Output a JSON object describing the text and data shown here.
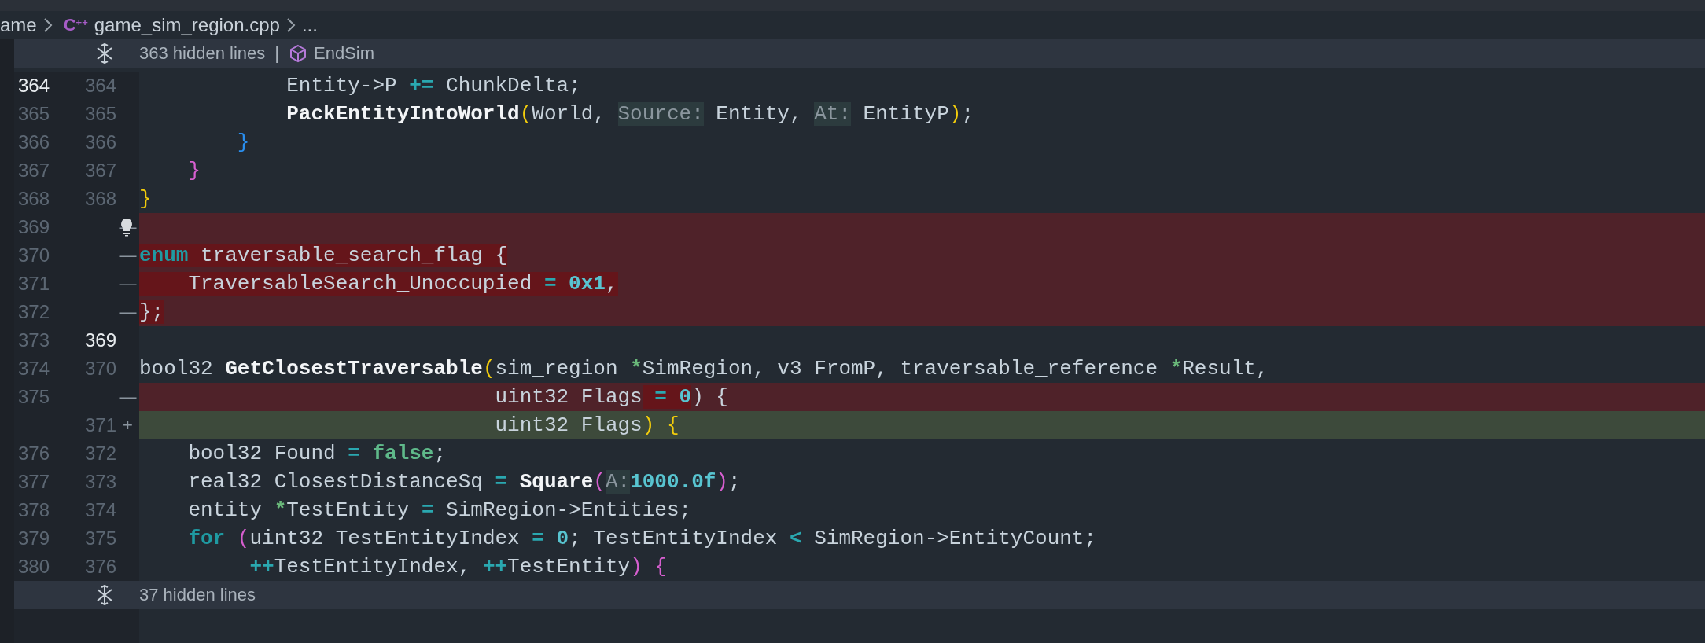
{
  "breadcrumb": {
    "items": [
      {
        "label": "ame"
      },
      {
        "label": "game_sim_region.cpp",
        "file_icon": "C$^{++}$"
      },
      {
        "label": "..."
      }
    ]
  },
  "fold_top": {
    "text": "363 hidden lines",
    "separator": "|",
    "symbol": "EndSim"
  },
  "lines": [
    {
      "old": "364",
      "new": "364",
      "kind": "context",
      "old_active": true,
      "new_active": false,
      "bulb": false,
      "tokens": [
        {
          "text": "            Entity->P",
          "kind": "plain",
          "emph": false
        },
        {
          "text": " +=",
          "kind": "op",
          "emph": false
        },
        {
          "text": " ChunkDelta;",
          "kind": "plain",
          "emph": false
        }
      ]
    },
    {
      "old": "365",
      "new": "365",
      "kind": "context",
      "old_active": false,
      "new_active": false,
      "bulb": false,
      "tokens": [
        {
          "text": "            PackEntityIntoWorld",
          "kind": "func",
          "emph": false
        },
        {
          "text": "(",
          "kind": "bracket",
          "color": "#f2cc0c",
          "emph": false
        },
        {
          "text": "World, ",
          "kind": "plain",
          "emph": false
        },
        {
          "text": "Source:",
          "kind": "hint",
          "emph": false
        },
        {
          "text": " Entity, ",
          "kind": "plain",
          "emph": false
        },
        {
          "text": "At:",
          "kind": "hint",
          "emph": false
        },
        {
          "text": " EntityP",
          "kind": "plain",
          "emph": false
        },
        {
          "text": ")",
          "kind": "bracket",
          "color": "#f2cc0c",
          "emph": false
        },
        {
          "text": ";",
          "kind": "plain",
          "emph": false
        }
      ]
    },
    {
      "old": "366",
      "new": "366",
      "kind": "context",
      "old_active": false,
      "new_active": false,
      "bulb": false,
      "tokens": [
        {
          "text": "        }",
          "kind": "bracket",
          "color": "#2a8ff0",
          "emph": false
        }
      ]
    },
    {
      "old": "367",
      "new": "367",
      "kind": "context",
      "old_active": false,
      "new_active": false,
      "bulb": false,
      "tokens": [
        {
          "text": "    }",
          "kind": "bracket",
          "color": "#d75fd0",
          "emph": false
        }
      ]
    },
    {
      "old": "368",
      "new": "368",
      "kind": "context",
      "old_active": false,
      "new_active": false,
      "bulb": false,
      "tokens": [
        {
          "text": "}",
          "kind": "bracket",
          "color": "#f2cc0c",
          "emph": false
        }
      ]
    },
    {
      "old": "369",
      "marker": "—",
      "kind": "removed",
      "old_active": false,
      "bulb": true
    },
    {
      "old": "370",
      "marker": "—",
      "kind": "removed",
      "old_active": false,
      "bulb": false,
      "tokens": [
        {
          "text": "enum",
          "kind": "keyword",
          "emph": true
        },
        {
          "text": " traversable_search_flag {",
          "kind": "plain",
          "emph": true
        }
      ]
    },
    {
      "old": "371",
      "marker": "—",
      "kind": "removed",
      "old_active": false,
      "bulb": false,
      "tokens": [
        {
          "text": "    TraversableSearch_Unoccupied",
          "kind": "plain",
          "emph": true
        },
        {
          "text": " =",
          "kind": "op",
          "emph": true
        },
        {
          "text": " 0x1",
          "kind": "num",
          "emph": true
        },
        {
          "text": ",",
          "kind": "plain",
          "emph": true
        }
      ]
    },
    {
      "old": "372",
      "marker": "—",
      "kind": "removed",
      "old_active": false,
      "bulb": false,
      "tokens": [
        {
          "text": "};",
          "kind": "plain",
          "emph": true
        }
      ]
    },
    {
      "old": "373",
      "new": "369",
      "kind": "context",
      "old_active": false,
      "new_active": true,
      "bulb": false
    },
    {
      "old": "374",
      "new": "370",
      "kind": "context",
      "old_active": false,
      "new_active": false,
      "bulb": false,
      "tokens": [
        {
          "text": "bool32 ",
          "kind": "plain",
          "emph": false
        },
        {
          "text": "GetClosestTraversable",
          "kind": "func",
          "emph": false
        },
        {
          "text": "(",
          "kind": "bracket",
          "color": "#f2cc0c",
          "emph": false
        },
        {
          "text": "sim_region ",
          "kind": "plain",
          "emph": false
        },
        {
          "text": "*",
          "kind": "pointer",
          "emph": false
        },
        {
          "text": "SimRegion, v3 FromP, traversable_reference ",
          "kind": "plain",
          "emph": false
        },
        {
          "text": "*",
          "kind": "pointer",
          "emph": false
        },
        {
          "text": "Result,",
          "kind": "plain",
          "emph": false
        }
      ]
    },
    {
      "old": "375",
      "marker": "—",
      "kind": "removed",
      "old_active": false,
      "bulb": false,
      "tokens": [
        {
          "text": "                             uint32 Flags",
          "kind": "plain",
          "emph": false
        },
        {
          "text": " =",
          "kind": "op",
          "emph": true
        },
        {
          "text": " 0",
          "kind": "num",
          "emph": true
        },
        {
          "text": ") {",
          "kind": "plain",
          "emph": false
        }
      ]
    },
    {
      "new": "371",
      "marker": "+",
      "kind": "added",
      "new_active": false,
      "bulb": false,
      "tokens": [
        {
          "text": "                             uint32 Flags",
          "kind": "plain",
          "emph": false
        },
        {
          "text": ")",
          "kind": "bracket",
          "color": "#f2cc0c",
          "emph": false
        },
        {
          "text": " {",
          "kind": "bracket",
          "color": "#f2cc0c",
          "emph": false
        }
      ]
    },
    {
      "old": "376",
      "new": "372",
      "kind": "context",
      "old_active": false,
      "new_active": false,
      "bulb": false,
      "tokens": [
        {
          "text": "    bool32 Found",
          "kind": "plain",
          "emph": false
        },
        {
          "text": " =",
          "kind": "op",
          "emph": false
        },
        {
          "text": " false",
          "kind": "literal",
          "emph": false
        },
        {
          "text": ";",
          "kind": "plain",
          "emph": false
        }
      ]
    },
    {
      "old": "377",
      "new": "373",
      "kind": "context",
      "old_active": false,
      "new_active": false,
      "bulb": false,
      "tokens": [
        {
          "text": "    real32 ClosestDistanceSq",
          "kind": "plain",
          "emph": false
        },
        {
          "text": " =",
          "kind": "op",
          "emph": false
        },
        {
          "text": " Square",
          "kind": "func",
          "emph": false
        },
        {
          "text": "(",
          "kind": "bracket",
          "color": "#d75fd0",
          "emph": false
        },
        {
          "text": "A:",
          "kind": "hint",
          "emph": false
        },
        {
          "text": "1000.0f",
          "kind": "num",
          "emph": false
        },
        {
          "text": ")",
          "kind": "bracket",
          "color": "#d75fd0",
          "emph": false
        },
        {
          "text": ";",
          "kind": "plain",
          "emph": false
        }
      ]
    },
    {
      "old": "378",
      "new": "374",
      "kind": "context",
      "old_active": false,
      "new_active": false,
      "bulb": false,
      "tokens": [
        {
          "text": "    entity ",
          "kind": "plain",
          "emph": false
        },
        {
          "text": "*",
          "kind": "pointer",
          "emph": false
        },
        {
          "text": "TestEntity",
          "kind": "plain",
          "emph": false
        },
        {
          "text": " =",
          "kind": "op",
          "emph": false
        },
        {
          "text": " SimRegion->Entities;",
          "kind": "plain",
          "emph": false
        }
      ]
    },
    {
      "old": "379",
      "new": "375",
      "kind": "context",
      "old_active": false,
      "new_active": false,
      "bulb": false,
      "tokens": [
        {
          "text": "    for",
          "kind": "keyword",
          "emph": false
        },
        {
          "text": " (",
          "kind": "bracket",
          "color": "#d75fd0",
          "emph": false
        },
        {
          "text": "uint32 TestEntityIndex",
          "kind": "plain",
          "emph": false
        },
        {
          "text": " =",
          "kind": "op",
          "emph": false
        },
        {
          "text": " 0",
          "kind": "num",
          "emph": false
        },
        {
          "text": "; TestEntityIndex",
          "kind": "plain",
          "emph": false
        },
        {
          "text": " <",
          "kind": "op",
          "emph": false
        },
        {
          "text": " SimRegion->EntityCount;",
          "kind": "plain",
          "emph": false
        }
      ]
    },
    {
      "old": "380",
      "new": "376",
      "kind": "context",
      "old_active": false,
      "new_active": false,
      "bulb": false,
      "tokens": [
        {
          "text": "         ++",
          "kind": "op",
          "emph": false
        },
        {
          "text": "TestEntityIndex, ",
          "kind": "plain",
          "emph": false
        },
        {
          "text": "++",
          "kind": "op",
          "emph": false
        },
        {
          "text": "TestEntity",
          "kind": "plain",
          "emph": false
        },
        {
          "text": ")",
          "kind": "bracket",
          "color": "#d75fd0",
          "emph": false
        },
        {
          "text": " {",
          "kind": "bracket",
          "color": "#d75fd0",
          "emph": false
        }
      ]
    }
  ],
  "fold_bottom": {
    "text": "37 hidden lines"
  }
}
